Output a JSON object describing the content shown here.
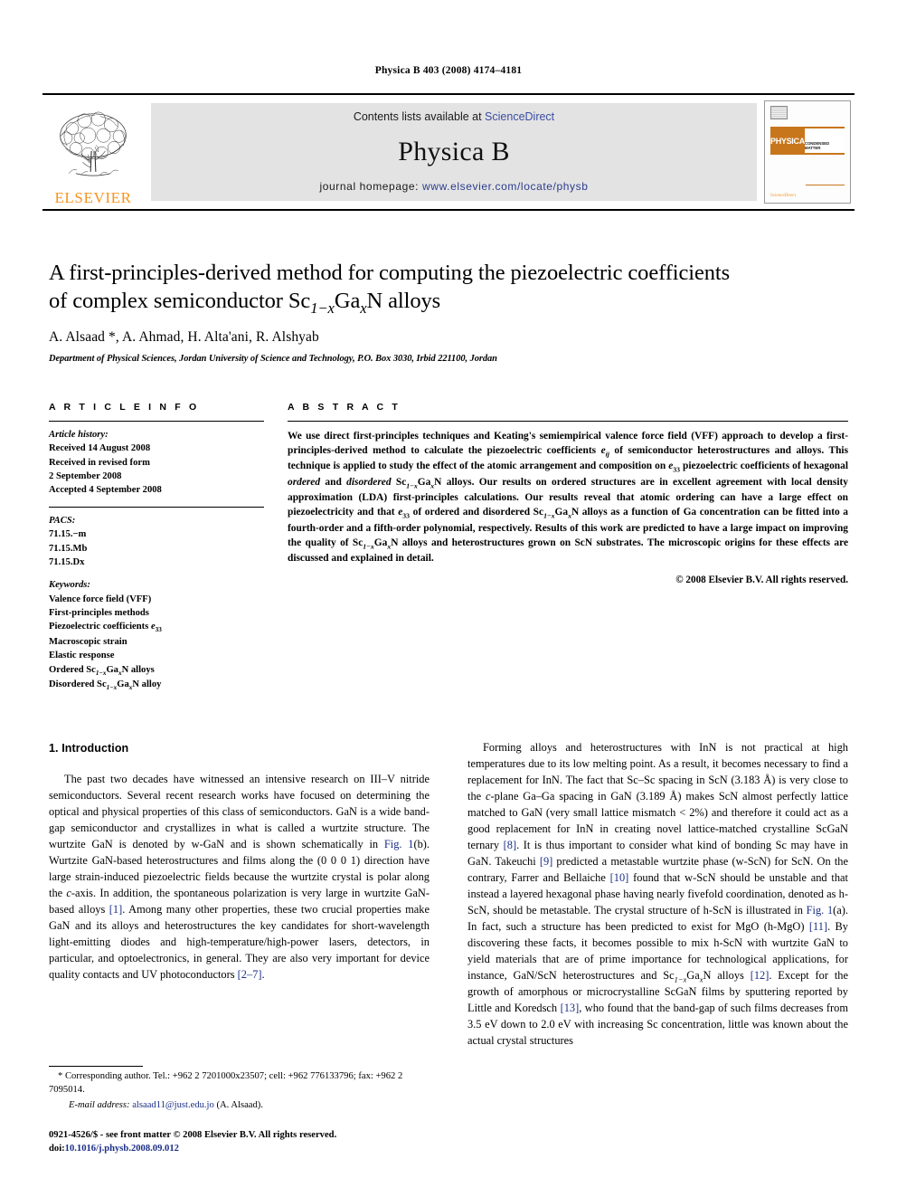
{
  "running_head": "Physica B 403 (2008) 4174–4181",
  "masthead": {
    "publisher_name": "ELSEVIER",
    "contents_prefix": "Contents lists available at ",
    "contents_link": "ScienceDirect",
    "journal_title": "Physica B",
    "homepage_prefix": "journal homepage: ",
    "homepage_url": "www.elsevier.com/locate/physb",
    "cover": {
      "band_left": "PHYSICA",
      "band_right": "CONDENSED MATTER",
      "band_sub": "ELSEVIER",
      "footer_logo": "ScienceDirect"
    }
  },
  "article": {
    "title_line1": "A first-principles-derived method for computing the piezoelectric coefficients",
    "title_line2_pre": "of complex semiconductor Sc",
    "title_sub1": "1−x",
    "title_mid": "Ga",
    "title_sub2": "x",
    "title_post": "N alloys",
    "authors": "A. Alsaad *, A. Ahmad, H. Alta'ani, R. Alshyab",
    "affiliation": "Department of Physical Sciences, Jordan University of Science and Technology, P.O. Box 3030, Irbid 221100, Jordan"
  },
  "article_info": {
    "heading": "A R T I C L E  I N F O",
    "history_label": "Article history:",
    "history": [
      "Received 14 August 2008",
      "Received in revised form",
      "2 September 2008",
      "Accepted 4 September 2008"
    ],
    "pacs_label": "PACS:",
    "pacs": [
      "71.15.−m",
      "71.15.Mb",
      "71.15.Dx"
    ],
    "keywords_label": "Keywords:",
    "keywords": [
      "Valence force field (VFF)",
      "First-principles methods",
      "Piezoelectric coefficients e33",
      "Macroscopic strain",
      "Elastic response",
      "Ordered Sc1−xGaxN alloys",
      "Disordered Sc1−xGaxN alloy"
    ]
  },
  "abstract": {
    "heading": "A B S T R A C T",
    "text": "We use direct first-principles techniques and Keating's semiempirical valence force field (VFF) approach to develop a first-principles-derived method to calculate the piezoelectric coefficients eij of semiconductor heterostructures and alloys. This technique is applied to study the effect of the atomic arrangement and composition on e33 piezoelectric coefficients of hexagonal ordered and disordered Sc1−xGaxN alloys. Our results on ordered structures are in excellent agreement with local density approximation (LDA) first-principles calculations. Our results reveal that atomic ordering can have a large effect on piezoelectricity and that e33 of ordered and disordered Sc1−xGaxN alloys as a function of Ga concentration can be fitted into a fourth-order and a fifth-order polynomial, respectively. Results of this work are predicted to have a large impact on improving the quality of Sc1−xGaxN alloys and heterostructures grown on ScN substrates. The microscopic origins for these effects are discussed and explained in detail.",
    "copyright": "© 2008 Elsevier B.V. All rights reserved."
  },
  "introduction": {
    "heading": "1.  Introduction",
    "left_paragraph": "The past two decades have witnessed an intensive research on III–V nitride semiconductors. Several recent research works have focused on determining the optical and physical properties of this class of semiconductors. GaN is a wide band-gap semiconductor and crystallizes in what is called a wurtzite structure. The wurtzite GaN is denoted by w-GaN and is shown schematically in Fig. 1(b). Wurtzite GaN-based heterostructures and films along the (0 0 0 1) direction have large strain-induced piezoelectric fields because the wurtzite crystal is polar along the c-axis. In addition, the spontaneous polarization is very large in wurtzite GaN-based alloys [1]. Among many other properties, these two crucial properties make GaN and its alloys and heterostructures the key candidates for short-wavelength light-emitting diodes and high-temperature/high-power lasers, detectors, in particular, and optoelectronics, in general. They are also very important for device quality contacts and UV photoconductors [2–7].",
    "right_paragraph": "Forming alloys and heterostructures with InN is not practical at high temperatures due to its low melting point. As a result, it becomes necessary to find a replacement for InN. The fact that Sc–Sc spacing in ScN (3.183 Å) is very close to the c-plane Ga–Ga spacing in GaN (3.189 Å) makes ScN almost perfectly lattice matched to GaN (very small lattice mismatch < 2%) and therefore it could act as a good replacement for InN in creating novel lattice-matched crystalline ScGaN ternary [8]. It is thus important to consider what kind of bonding Sc may have in GaN. Takeuchi [9] predicted a metastable wurtzite phase (w-ScN) for ScN. On the contrary, Farrer and Bellaiche [10] found that w-ScN should be unstable and that instead a layered hexagonal phase having nearly fivefold coordination, denoted as h-ScN, should be metastable. The crystal structure of h-ScN is illustrated in Fig. 1(a). In fact, such a structure has been predicted to exist for MgO (h-MgO) [11]. By discovering these facts, it becomes possible to mix h-ScN with wurtzite GaN to yield materials that are of prime importance for technological applications, for instance, GaN/ScN heterostructures and Sc1−xGaxN alloys [12]. Except for the growth of amorphous or microcrystalline ScGaN films by sputtering reported by Little and Koredsch [13], who found that the band-gap of such films decreases from 3.5 eV down to 2.0 eV with increasing Sc concentration, little was known about the actual crystal structures"
  },
  "footnotes": {
    "corresponding": "* Corresponding author. Tel.: +962 2 7201000x23507; cell: +962 776133796;",
    "corresponding_line2": "fax: +962 2 7095014.",
    "email_label": "E-mail address:",
    "email": "alsaad11@just.edu.jo",
    "email_suffix": "(A. Alsaad).",
    "issn_line": "0921-4526/$ - see front matter © 2008 Elsevier B.V. All rights reserved.",
    "doi_label": "doi:",
    "doi": "10.1016/j.physb.2008.09.012"
  },
  "colors": {
    "link": "#1b2f86",
    "elsevier_orange": "#F7941E",
    "cover_orange": "#C8761B",
    "band_gray": "#e3e3e3"
  }
}
